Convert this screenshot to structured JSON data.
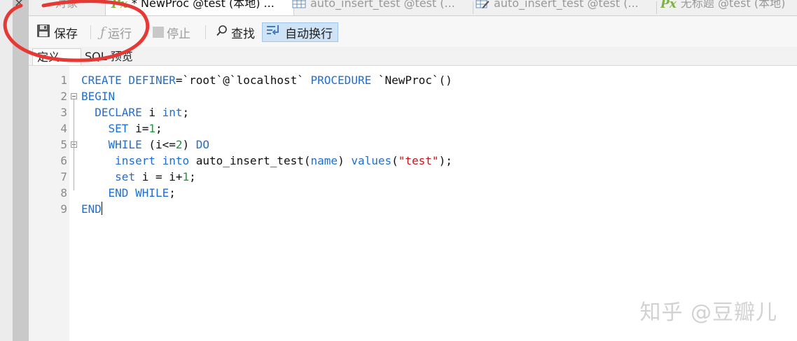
{
  "window": {
    "close_glyph": "×"
  },
  "tabs": [
    {
      "label": "对象",
      "icon": "none",
      "active": false
    },
    {
      "label": "* NewProc @test (本地) ...",
      "icon": "procedure-px-icon",
      "active": true
    },
    {
      "label": "auto_insert_test @test (...",
      "icon": "table-grid-icon",
      "active": false
    },
    {
      "label": "auto_insert_test @test (...",
      "icon": "table-edit-icon",
      "active": false
    },
    {
      "label": "无标题 @test (本地)",
      "icon": "procedure-px-icon",
      "active": false
    }
  ],
  "toolbar": {
    "save_label": "保存",
    "run_label": "运行",
    "stop_label": "停止",
    "find_label": "查找",
    "wrap_label": "自动换行"
  },
  "subtabs": [
    {
      "label": "定义",
      "active": true
    },
    {
      "label": "SQL 预览",
      "active": false
    }
  ],
  "editor": {
    "line_numbers": [
      "1",
      "2",
      "3",
      "4",
      "5",
      "6",
      "7",
      "8",
      "9"
    ],
    "lines": [
      [
        {
          "t": "CREATE DEFINER",
          "c": "kw"
        },
        {
          "t": "=`root`@`localhost` ",
          "c": "p"
        },
        {
          "t": "PROCEDURE",
          "c": "kw"
        },
        {
          "t": " `NewProc`()",
          "c": "p"
        }
      ],
      [
        {
          "t": "BEGIN",
          "c": "kw"
        }
      ],
      [
        {
          "t": "  ",
          "c": "p"
        },
        {
          "t": "DECLARE",
          "c": "kw"
        },
        {
          "t": " i ",
          "c": "p"
        },
        {
          "t": "int",
          "c": "kw"
        },
        {
          "t": ";",
          "c": "p"
        }
      ],
      [
        {
          "t": "    ",
          "c": "p"
        },
        {
          "t": "SET",
          "c": "kw"
        },
        {
          "t": " i=",
          "c": "p"
        },
        {
          "t": "1",
          "c": "num"
        },
        {
          "t": ";",
          "c": "p"
        }
      ],
      [
        {
          "t": "    ",
          "c": "p"
        },
        {
          "t": "WHILE",
          "c": "kw"
        },
        {
          "t": " (i<=",
          "c": "p"
        },
        {
          "t": "2",
          "c": "num"
        },
        {
          "t": ") ",
          "c": "p"
        },
        {
          "t": "DO",
          "c": "kw"
        }
      ],
      [
        {
          "t": "     ",
          "c": "p"
        },
        {
          "t": "insert into",
          "c": "kw"
        },
        {
          "t": " auto_insert_test(",
          "c": "p"
        },
        {
          "t": "name",
          "c": "kw"
        },
        {
          "t": ") ",
          "c": "p"
        },
        {
          "t": "values",
          "c": "kw"
        },
        {
          "t": "(",
          "c": "p"
        },
        {
          "t": "\"test\"",
          "c": "str"
        },
        {
          "t": ");",
          "c": "p"
        }
      ],
      [
        {
          "t": "     ",
          "c": "p"
        },
        {
          "t": "set",
          "c": "kw"
        },
        {
          "t": " i = i+",
          "c": "p"
        },
        {
          "t": "1",
          "c": "num"
        },
        {
          "t": ";",
          "c": "p"
        }
      ],
      [
        {
          "t": "    ",
          "c": "p"
        },
        {
          "t": "END WHILE",
          "c": "kw"
        },
        {
          "t": ";",
          "c": "p"
        }
      ],
      [
        {
          "t": "END",
          "c": "kw"
        }
      ]
    ]
  },
  "watermark": "知乎 @豆瓣儿",
  "colors": {
    "keyword": "#1f6fd1",
    "number": "#1a9a3c",
    "string": "#c21818",
    "annotation": "#e53935"
  }
}
